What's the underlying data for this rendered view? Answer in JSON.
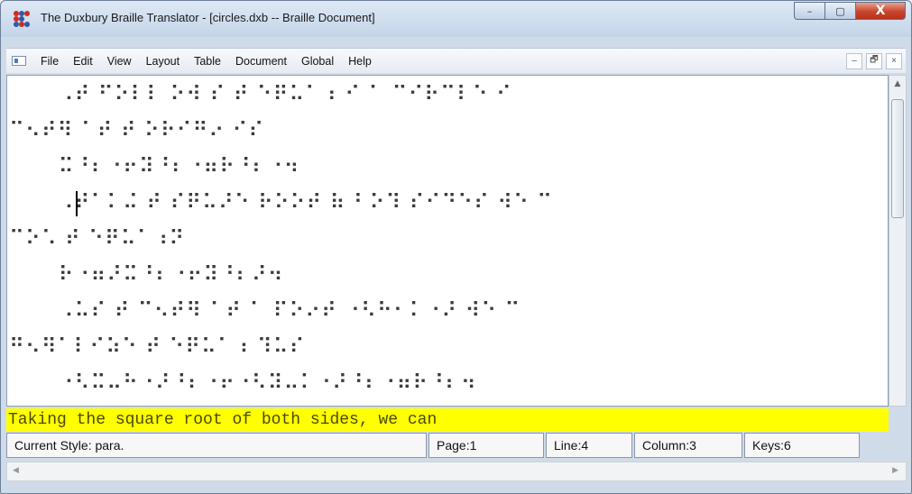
{
  "window": {
    "title": "The Duxbury Braille Translator - [circles.dxb -- Braille Document]",
    "icon": "braille-app-icon",
    "caption": {
      "minimize": "–",
      "maximize": "▢",
      "close": "X"
    }
  },
  "menubar": {
    "items": [
      "File",
      "Edit",
      "View",
      "Layout",
      "Table",
      "Document",
      "Global",
      "Help"
    ],
    "mdi": {
      "minimize": "–",
      "restore": "🗗",
      "close": "×"
    }
  },
  "editor": {
    "lines": [
      "  ⠠⠞ ⠋⠕⠇⠇ ⠕⠺ ⠎ ⠞ ⠑⠟⠥⠁⠰ ⠊ ⠁ ⠉⠊⠗⠉⠇⠑ ⠊",
      "⠉⠢⠞⠻ ⠁⠞ ⠞ ⠕⠗⠊⠛⠔ ⠊⠎",
      "  ⠭⠘⠆⠐⠖⠽⠘⠆⠐⠶⠗⠘⠆⠐⠲",
      "  ⠠⠞⠁⠅⠬ ⠞ ⠎⠟⠥⠜⠑ ⠗⠕⠕⠞ ⠷ ⠃⠕⠹ ⠎⠊⠙⠑⠎ ⠺⠑ ⠉",
      "⠉⠕⠡ ⠞ ⠑⠟⠥⠁⠰⠝",
      "  ⠗⠐⠶⠜⠭⠘⠆⠐⠖⠽⠘⠆⠜⠲",
      "  ⠠⠥⠎ ⠞ ⠉⠢⠞⠻ ⠁⠞ ⠁ ⠏⠕⠔⠞ ⠐⠣⠓⠂⠅⠐⠜ ⠺⠑ ⠉",
      "⠛⠢⠻⠁⠇⠊⠵⠑ ⠞ ⠑⠟⠥⠁⠰ ⠹⠥⠎",
      "  ⠐⠣⠭⠤⠓⠐⠜⠘⠆⠐⠖⠐⠣⠽⠤⠅⠐⠜⠘⠆⠐⠶⠗⠘⠆⠲"
    ]
  },
  "preview": {
    "text": "Taking the square root of both sides, we can",
    "highlight_color": "#ffff00"
  },
  "status": {
    "style": "Current Style: para.",
    "page": "Page:1",
    "line": "Line:4",
    "column": "Column:3",
    "keys": "Keys:6"
  }
}
